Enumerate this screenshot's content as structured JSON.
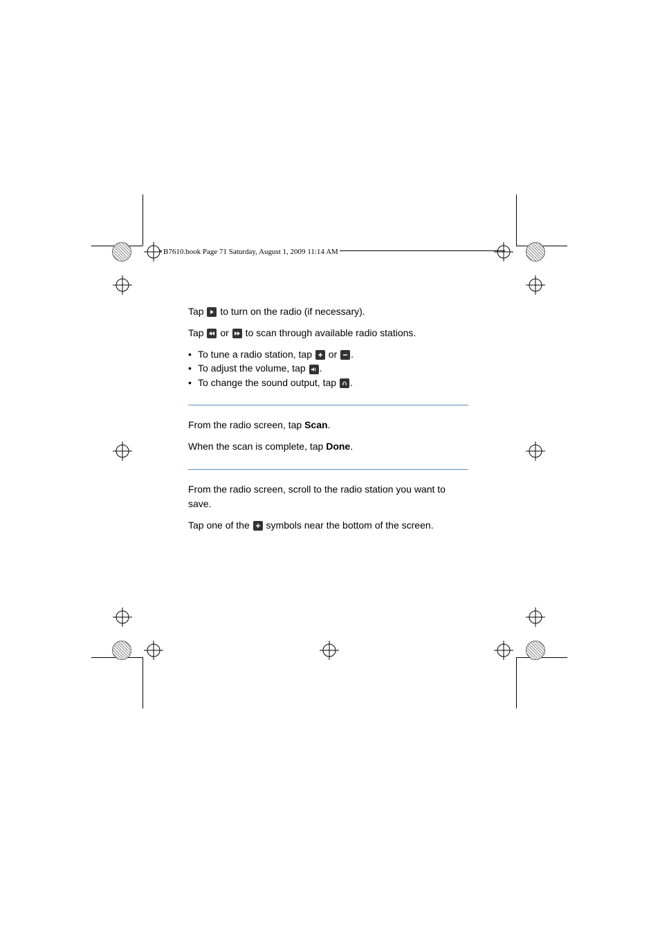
{
  "header": {
    "crop_text": "B7610.book  Page 71  Saturday, August 1, 2009  11:14 AM"
  },
  "content": {
    "line1_a": "Tap ",
    "line1_b": " to turn on the radio (if necessary).",
    "line2_a": "Tap ",
    "line2_b": " or ",
    "line2_c": " to scan through available radio stations.",
    "bullet1_a": "To tune a radio station, tap ",
    "bullet1_b": " or ",
    "bullet1_c": ".",
    "bullet2_a": "To adjust the volume, tap ",
    "bullet2_b": ".",
    "bullet3_a": "To change the sound output, tap ",
    "bullet3_b": ".",
    "sec2_line1_a": "From the radio screen, tap ",
    "sec2_scan": "Scan",
    "sec2_line1_b": ".",
    "sec2_line2_a": "When the scan is complete, tap ",
    "sec2_done": "Done",
    "sec2_line2_b": ".",
    "sec3_line1": "From the radio screen, scroll to the radio station you want to save.",
    "sec3_line2_a": "Tap one of the ",
    "sec3_line2_b": " symbols near the bottom of the screen."
  }
}
